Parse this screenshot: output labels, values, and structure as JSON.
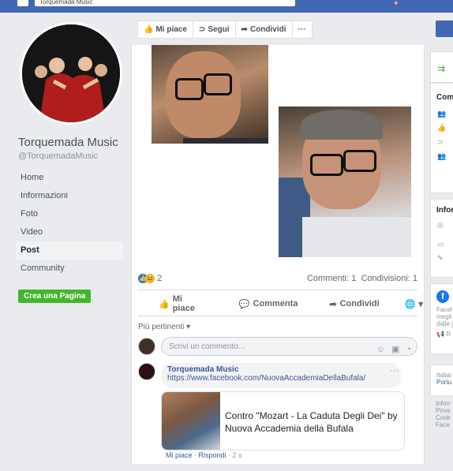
{
  "topbar": {
    "search_text": "Torquemada Music"
  },
  "page": {
    "name": "Torquemada Music",
    "handle": "@TorquemadaMusic",
    "nav": [
      "Home",
      "Informazioni",
      "Foto",
      "Video",
      "Post",
      "Community"
    ],
    "active_nav": "Post",
    "create_page_label": "Crea una Pagina"
  },
  "actionbar": {
    "like": "Mi piace",
    "follow": "Segui",
    "share": "Condividi",
    "more": "···"
  },
  "post": {
    "reaction_count": "2",
    "comments_count": "Commenti: 1",
    "shares_count": "Condivisioni: 1",
    "actions": {
      "like": "Mi piace",
      "comment": "Commenta",
      "share": "Condividi"
    },
    "sort_label": "Più pertinenti ▾",
    "comment_placeholder": "Scrivi un commento...",
    "comment": {
      "author": "Torquemada Music",
      "link": "https://www.facebook.com/NuovaAccademiaDellaBufala/",
      "preview_title": "Contro \"Mozart - La Caduta Degli Dei\" by Nuova Accademia della Bufala",
      "like": "Mi piace",
      "reply": "Rispondi",
      "time": "2 s"
    }
  },
  "right_col": {
    "h1": "Com",
    "h2": "Infor",
    "fb_text": [
      "Facel",
      "megli",
      "dalle j"
    ],
    "fb_icon_label": "R",
    "lang": "Italiar",
    "lang_link": "Portu",
    "footer": [
      "Inforr",
      "Priva",
      "Cook",
      "Face"
    ]
  },
  "colors": {
    "brand": "#4267b2",
    "link": "#385898",
    "green": "#42b72a"
  }
}
